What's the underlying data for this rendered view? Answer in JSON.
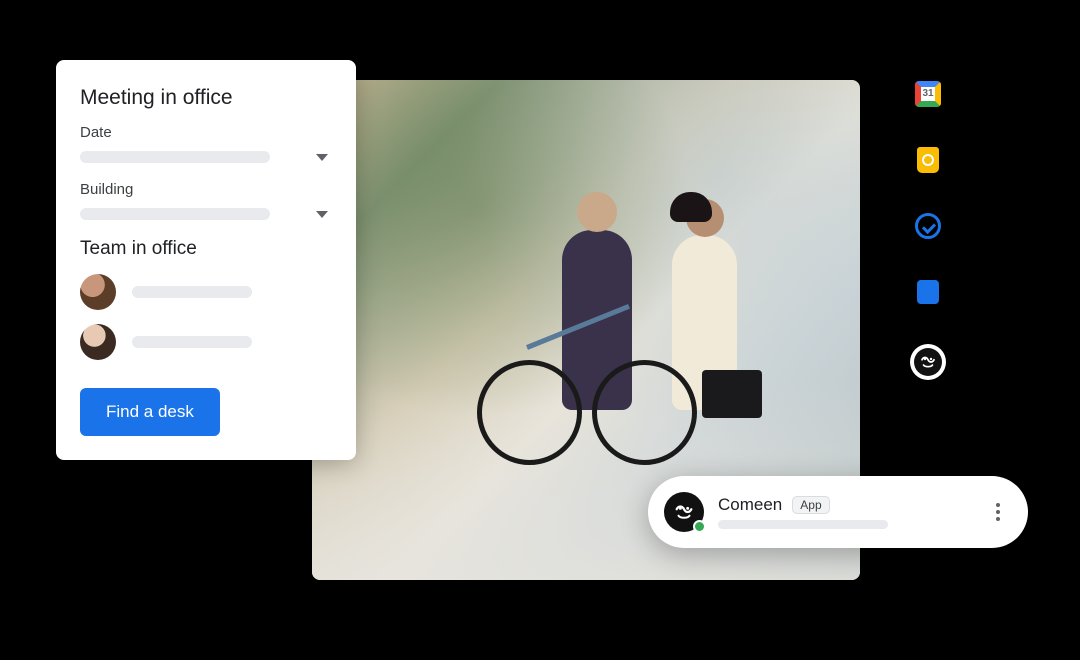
{
  "card": {
    "title": "Meeting in office",
    "date_label": "Date",
    "building_label": "Building",
    "team_heading": "Team in office",
    "cta_label": "Find a desk"
  },
  "rail": {
    "calendar": {
      "name": "calendar-icon",
      "day_number": "31"
    },
    "keep": {
      "name": "keep-icon"
    },
    "tasks": {
      "name": "tasks-icon"
    },
    "contacts": {
      "name": "contacts-icon"
    },
    "comeen": {
      "name": "comeen-icon"
    }
  },
  "pill": {
    "app_name": "Comeen",
    "badge_label": "App"
  },
  "colors": {
    "primary": "#1a73e8",
    "presence": "#34a853"
  }
}
